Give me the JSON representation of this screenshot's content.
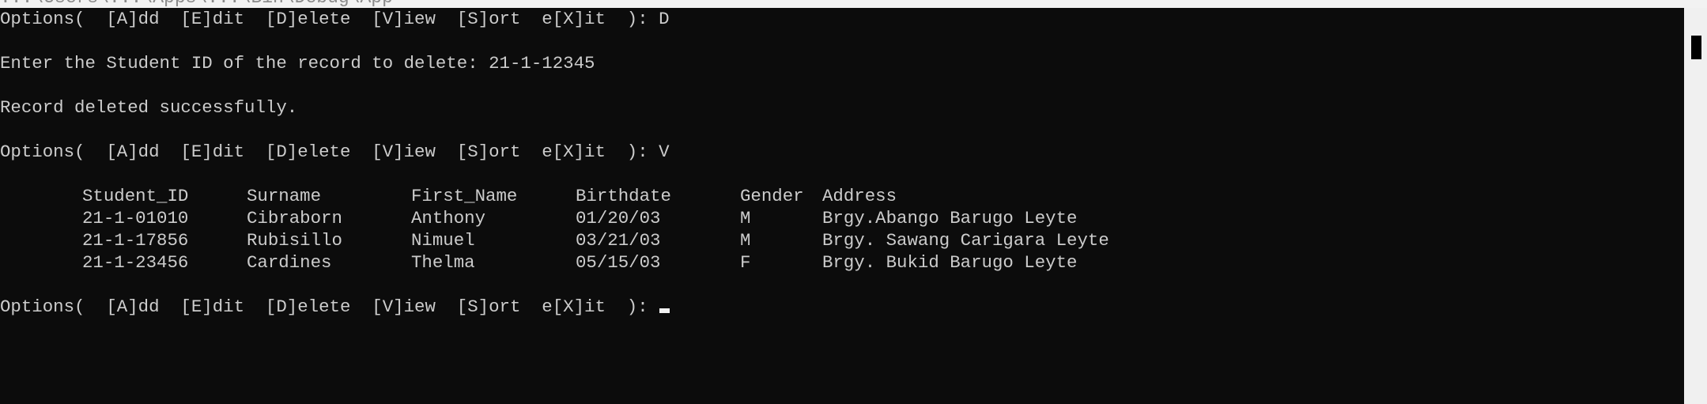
{
  "window": {
    "title_fragment": "...\\Users\\...\\Apps\\...\\Bin\\Debug\\App"
  },
  "console": {
    "lines": [
      "Options(  [A]dd  [E]dit  [D]elete  [V]iew  [S]ort  e[X]it  ): D",
      "",
      "Enter the Student ID of the record to delete: 21-1-12345",
      "",
      "Record deleted successfully.",
      "",
      "Options(  [A]dd  [E]dit  [D]elete  [V]iew  [S]ort  e[X]it  ): V"
    ],
    "table": {
      "headers": [
        "Student_ID",
        "Surname",
        "First_Name",
        "Birthdate",
        "Gender",
        "Address"
      ],
      "rows": [
        [
          "21-1-01010",
          "Cibraborn",
          "Anthony",
          "01/20/03",
          "M",
          "Brgy.Abango Barugo Leyte"
        ],
        [
          "21-1-17856",
          "Rubisillo",
          "Nimuel",
          "03/21/03",
          "M",
          "Brgy. Sawang Carigara Leyte"
        ],
        [
          "21-1-23456",
          "Cardines",
          "Thelma",
          "05/15/03",
          "F",
          "Brgy. Bukid Barugo Leyte"
        ]
      ]
    },
    "prompt": "Options(  [A]dd  [E]dit  [D]elete  [V]iew  [S]ort  e[X]it  ): "
  },
  "colors": {
    "background": "#0c0c0c",
    "text": "#cccccc",
    "cursor": "#f2f2f2",
    "scrollbar_track": "#f0f0f0",
    "scrollbar_thumb": "#000000"
  }
}
